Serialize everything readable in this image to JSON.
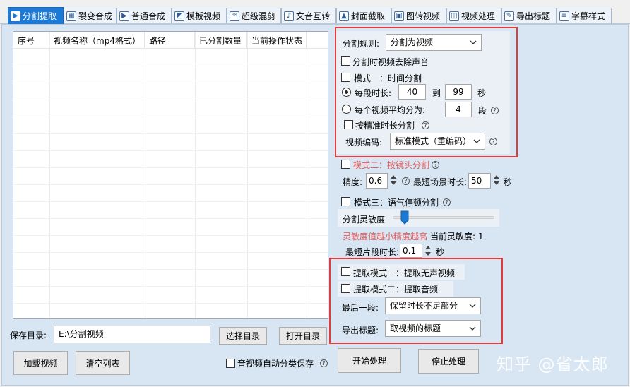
{
  "tabs": [
    {
      "label": "分割提取",
      "icon": "play-icon",
      "glyph": "▶"
    },
    {
      "label": "裂变合成",
      "icon": "film-icon",
      "glyph": "▦"
    },
    {
      "label": "普通合成",
      "icon": "play-icon",
      "glyph": "▶"
    },
    {
      "label": "模板视频",
      "icon": "template-icon",
      "glyph": "◩"
    },
    {
      "label": "超级混剪",
      "icon": "waveform-icon",
      "glyph": "♒"
    },
    {
      "label": "文音互转",
      "icon": "microphone-icon",
      "glyph": "♪"
    },
    {
      "label": "封面截取",
      "icon": "image-icon",
      "glyph": "▲"
    },
    {
      "label": "图转视频",
      "icon": "slideshow-icon",
      "glyph": "▣"
    },
    {
      "label": "视频处理",
      "icon": "video-process-icon",
      "glyph": "◫"
    },
    {
      "label": "导出标题",
      "icon": "edit-icon",
      "glyph": "✎"
    },
    {
      "label": "字幕样式",
      "icon": "subtitle-icon",
      "glyph": "≡"
    }
  ],
  "table": {
    "columns": [
      "序号",
      "视频名称（mp4格式）",
      "路径",
      "已分割数量",
      "当前操作状态"
    ],
    "rows": []
  },
  "bottom": {
    "save_dir_label": "保存目录:",
    "save_dir_value": "E:\\分割视频",
    "choose_dir": "选择目录",
    "open_dir": "打开目录",
    "load_video": "加载视频",
    "clear_list": "清空列表",
    "auto_classify": "音视频自动分类保存",
    "start": "开始处理",
    "stop": "停止处理"
  },
  "split": {
    "rule_label": "分割规则:",
    "rule_value": "分割为视频",
    "remove_audio": "分割时视频去除声音",
    "mode1": "模式一：时间分割",
    "per_segment": "每段时长:",
    "seg_from": "40",
    "to": "到",
    "seg_to": "99",
    "sec": "秒",
    "avg_split": "每个视频平均分为:",
    "avg_value": "4",
    "segment_unit": "段",
    "precise": "按精准时长分割",
    "encode_label": "视频编码:",
    "encode_value": "标准模式（重编码）",
    "mode2": "模式二：按镜头分割",
    "precision_label": "精度:",
    "precision_value": "0.6",
    "min_scene_label": "最短场景时长:",
    "min_scene_value": "50",
    "sec2": "秒",
    "mode3": "模式三：语气停顿分割",
    "sensitivity_label": "分割灵敏度",
    "sensitivity_level": 0.1,
    "sensitivity_hint": "灵敏度值越小精度越高",
    "current_sensitivity": "当前灵敏度: 1",
    "min_clip_label": "最短片段时长:",
    "min_clip_value": "0.1",
    "sec3": "秒"
  },
  "extract": {
    "mode1": "提取模式一：提取无声视频",
    "mode2": "提取模式二：提取音频",
    "last_segment_label": "最后一段:",
    "last_segment_value": "保留时长不足部分",
    "export_title_label": "导出标题:",
    "export_title_value": "取视频的标题"
  },
  "help_glyph": "?",
  "watermark": "知乎 @省太郎",
  "colors": {
    "accent": "#1c7ad6",
    "panel": "#d8e6f3",
    "highlight": "#e23b3b",
    "warn": "#e45a5a"
  }
}
